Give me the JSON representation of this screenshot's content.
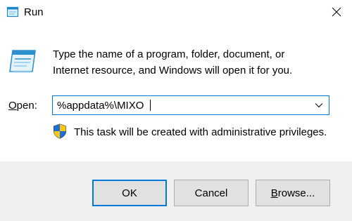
{
  "window": {
    "title": "Run"
  },
  "icons": {
    "title_icon": "run-icon",
    "main_icon": "run-icon",
    "close": "close-icon",
    "dropdown": "chevron-down-icon",
    "shield": "uac-shield-icon"
  },
  "description": {
    "line1": "Type the name of a program, folder, document, or",
    "line2": "Internet resource, and Windows will open it for you."
  },
  "open_field": {
    "label_mnemonic": "O",
    "label_rest": "pen:",
    "value": "%appdata%\\MIXO"
  },
  "admin_notice": "This task will be created with administrative privileges.",
  "buttons": {
    "ok": "OK",
    "cancel": "Cancel",
    "browse_mnemonic": "B",
    "browse_rest": "rowse..."
  },
  "colors": {
    "accent": "#0078d7",
    "footer_bg": "#f0f0f0",
    "button_bg": "#e1e1e1",
    "button_border": "#adadad"
  }
}
